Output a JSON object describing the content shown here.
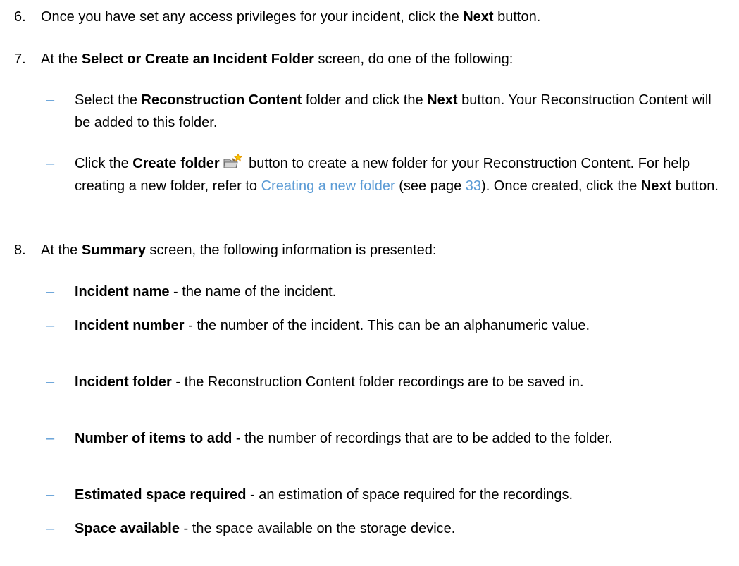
{
  "steps": [
    {
      "number": "6.",
      "parts": [
        "Once you have set any access privileges for your incident, click the ",
        "Next",
        " button."
      ]
    },
    {
      "number": "7.",
      "parts": [
        "At the ",
        "Select or Create an Incident Folder",
        " screen, do one of the following:"
      ],
      "bullets": [
        {
          "marker": "–",
          "parts": [
            "Select the ",
            "Reconstruction Content",
            " folder and click the ",
            "Next",
            " button. Your Reconstruction Content will be added to this folder."
          ]
        },
        {
          "marker": "–",
          "parts": [
            "Click the ",
            "Create folder",
            " button to create a new folder for your Reconstruction Content. For help creating a new folder, refer to ",
            "Creating a new folder",
            " (see page ",
            "33",
            "). Once created, click the ",
            "Next",
            " button."
          ],
          "icon": "create-folder-icon"
        }
      ]
    },
    {
      "number": "8.",
      "parts": [
        "At the ",
        "Summary",
        " screen, the following information is presented:"
      ],
      "bullets": [
        {
          "marker": "–",
          "term": "Incident name",
          "desc": " - the name of the incident."
        },
        {
          "marker": "–",
          "term": "Incident number",
          "desc": " - the number of the incident. This can be an alphanumeric value."
        },
        {
          "marker": "–",
          "term": "Incident folder",
          "desc": " - the Reconstruction Content folder recordings are to be saved in."
        },
        {
          "marker": "–",
          "term": "Number of items to add",
          "desc": " - the number of recordings that are to be added to the folder."
        },
        {
          "marker": "–",
          "term": "Estimated space required",
          "desc": " - an estimation of space required for the recordings."
        },
        {
          "marker": "–",
          "term": "Space available",
          "desc": " - the space available on the storage device."
        }
      ]
    }
  ],
  "colors": {
    "link": "#5b9bd5",
    "dash": "#5b9bd5"
  }
}
